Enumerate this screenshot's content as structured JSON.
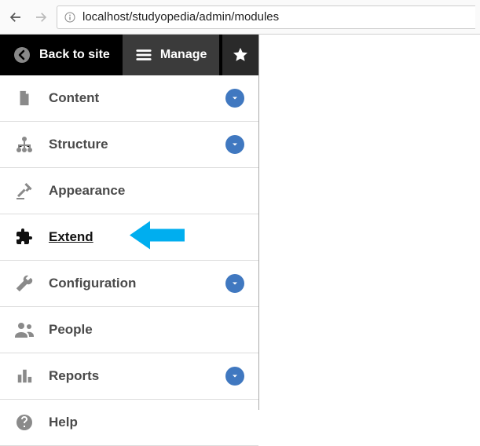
{
  "browser": {
    "url": "localhost/studyopedia/admin/modules"
  },
  "toolbar": {
    "back_label": "Back to site",
    "manage_label": "Manage"
  },
  "menu": {
    "items": [
      {
        "label": "Content",
        "expandable": true
      },
      {
        "label": "Structure",
        "expandable": true
      },
      {
        "label": "Appearance",
        "expandable": false
      },
      {
        "label": "Extend",
        "expandable": false,
        "highlight": true
      },
      {
        "label": "Configuration",
        "expandable": true
      },
      {
        "label": "People",
        "expandable": false
      },
      {
        "label": "Reports",
        "expandable": true
      },
      {
        "label": "Help",
        "expandable": false
      }
    ]
  }
}
